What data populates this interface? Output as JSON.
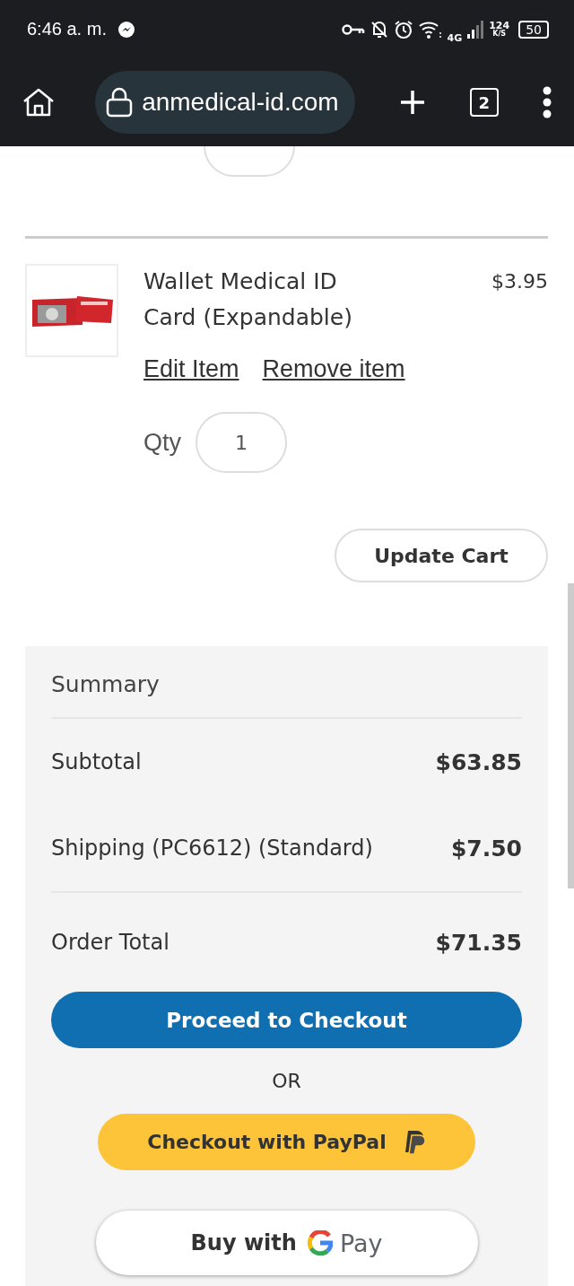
{
  "status_bar": {
    "time": "6:46 a. m.",
    "network": "4G",
    "speed_value": "124",
    "speed_unit": "K/S",
    "battery": "50"
  },
  "browser": {
    "url": "anmedical-id.com",
    "tab_count": "2"
  },
  "cart_item": {
    "name": "Wallet Medical ID Card (Expandable)",
    "price": "$3.95",
    "links": [
      "Edit Item",
      "Remove item"
    ],
    "qty_label": "Qty",
    "qty": "1"
  },
  "update_button": "Update Cart",
  "summary": {
    "title": "Summary",
    "rows": [
      {
        "label": "Subtotal",
        "value": "$63.85",
        "kind": "line"
      },
      {
        "label": "Shipping (PC6612) (Standard)",
        "value": "$7.50",
        "kind": "line"
      },
      {
        "label": "Order Total",
        "value": "$71.35",
        "kind": "total"
      }
    ],
    "checkout_button": "Proceed to Checkout",
    "or": "OR",
    "paypal_button": "Checkout with PayPal",
    "gpay_prefix": "Buy with",
    "gpay_word": "Pay"
  }
}
